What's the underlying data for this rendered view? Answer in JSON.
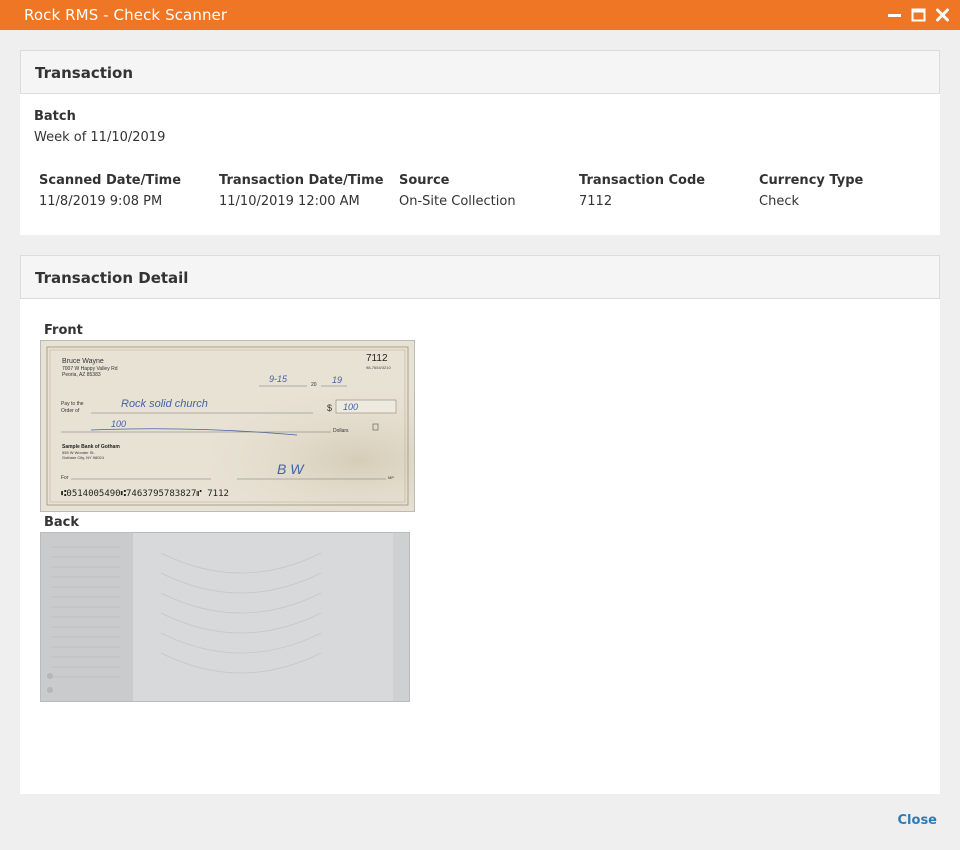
{
  "window": {
    "title": "Rock RMS - Check Scanner",
    "controls": [
      "minimize-icon",
      "maximize-icon",
      "close-icon"
    ]
  },
  "transaction": {
    "heading": "Transaction",
    "batch_label": "Batch",
    "batch_value": "Week of 11/10/2019",
    "fields": [
      {
        "label": "Scanned Date/Time",
        "value": "11/8/2019 9:08 PM"
      },
      {
        "label": "Transaction Date/Time",
        "value": "11/10/2019 12:00 AM"
      },
      {
        "label": "Source",
        "value": "On-Site Collection"
      },
      {
        "label": "Transaction Code",
        "value": "7112"
      },
      {
        "label": "Currency Type",
        "value": "Check"
      }
    ]
  },
  "detail": {
    "heading": "Transaction Detail",
    "front_label": "Front",
    "back_label": "Back"
  },
  "check": {
    "name": "Bruce Wayne",
    "address1": "7007 W Happy Valley Rd",
    "address2": "Peoria, AZ 85383",
    "number": "7112",
    "routing_small": "98-7654/3210",
    "date": "9-15",
    "date_prefix": "20",
    "date_year": "19",
    "pay_to_line1": "Pay to the",
    "pay_to_line2": "Order of",
    "payee": "Rock solid church",
    "amount_sign": "$",
    "amount": "100",
    "written_amount": "100",
    "dollars": "Dollars",
    "bank_name": "Sample Bank of Gotham",
    "bank_addr1": "555 W Wonder St.",
    "bank_addr2": "Gotham City, NY 98024",
    "memo": "For",
    "signature": "B W",
    "micr": "⑆0514005490⑆7463795783827⑈ 7112",
    "mp": "MP"
  },
  "footer": {
    "close_label": "Close"
  },
  "colors": {
    "accent": "#ee7625",
    "link": "#2b7bb9"
  }
}
